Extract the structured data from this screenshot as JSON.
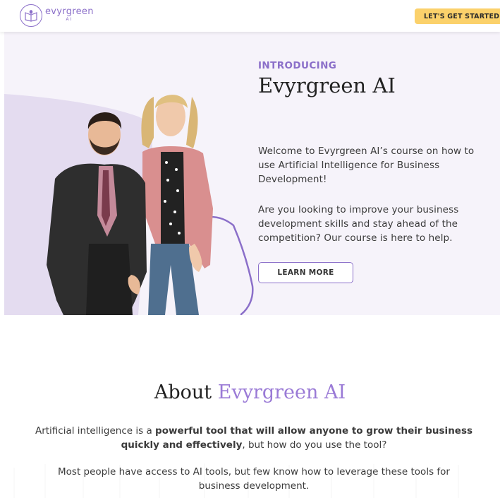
{
  "header": {
    "logo_word": "evyrgreen",
    "logo_sub": "AI",
    "cta_label": "LET'S GET STARTED",
    "logo_icon": "book-leaf-icon"
  },
  "hero": {
    "eyebrow": "INTRODUCING",
    "title": "Evyrgreen AI",
    "paragraph1": "Welcome to Evyrgreen AI’s course on how to use Artificial Intelligence for Business Development!",
    "paragraph2": "Are you looking to improve your business development skills and stay ahead of the competition? Our course is here to help.",
    "button_label": "LEARN MORE"
  },
  "about": {
    "title_plain": "About",
    "title_accent": "Evyrgreen AI",
    "p1_start": "Artificial intelligence is a ",
    "p1_bold": "powerful tool that will allow anyone to grow their business quickly and effectively",
    "p1_end": ", but how do you use the tool?",
    "p2": "Most people have access to AI tools, but few know how to leverage these tools for business development."
  },
  "colors": {
    "accent": "#8b6fc9",
    "cta_yellow": "#fbd16b",
    "hero_bg": "#f6f3fa"
  }
}
